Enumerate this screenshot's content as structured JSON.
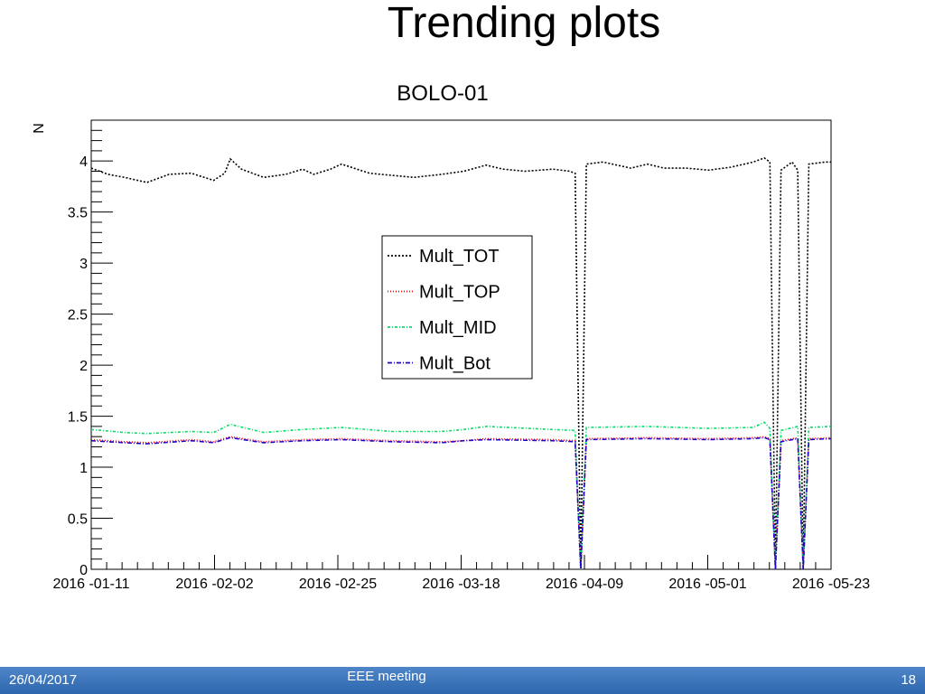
{
  "slide": {
    "title": "Trending plots"
  },
  "footer": {
    "date": "26/04/2017",
    "meeting": "EEE meeting",
    "page": "18"
  },
  "chart_data": {
    "type": "line",
    "title": "BOLO-01",
    "xlabel": "",
    "ylabel": "N",
    "x_axis": "date",
    "xlim": [
      "2016-01-11",
      "2016-05-23"
    ],
    "ylim": [
      0,
      4.4
    ],
    "xticks": [
      "2016 -01-11",
      "2016 -02-02",
      "2016 -02-25",
      "2016 -03-18",
      "2016 -04-09",
      "2016 -05-01",
      "2016 -05-23"
    ],
    "yticks": [
      "0",
      "0.5",
      "1",
      "1.5",
      "2",
      "2.5",
      "3",
      "3.5",
      "4"
    ],
    "grid": false,
    "legend_position": "center",
    "series": [
      {
        "name": "Mult_TOT",
        "color": "#000000",
        "dash": "2,2",
        "x": [
          "2016-01-11",
          "2016-01-14",
          "2016-01-17",
          "2016-01-21",
          "2016-01-25",
          "2016-01-29",
          "2016-02-02",
          "2016-02-04",
          "2016-02-05",
          "2016-02-07",
          "2016-02-11",
          "2016-02-15",
          "2016-02-18",
          "2016-02-20",
          "2016-02-23",
          "2016-02-25",
          "2016-03-01",
          "2016-03-05",
          "2016-03-09",
          "2016-03-14",
          "2016-03-18",
          "2016-03-22",
          "2016-03-25",
          "2016-03-29",
          "2016-04-03",
          "2016-04-06",
          "2016-04-07",
          "2016-04-08",
          "2016-04-09",
          "2016-04-12",
          "2016-04-17",
          "2016-04-20",
          "2016-04-23",
          "2016-04-27",
          "2016-05-01",
          "2016-05-05",
          "2016-05-09",
          "2016-05-11",
          "2016-05-12",
          "2016-05-13",
          "2016-05-14",
          "2016-05-16",
          "2016-05-17",
          "2016-05-18",
          "2016-05-19",
          "2016-05-22",
          "2016-05-23"
        ],
        "values": [
          3.93,
          3.87,
          3.84,
          3.79,
          3.87,
          3.88,
          3.81,
          3.88,
          4.02,
          3.92,
          3.84,
          3.87,
          3.92,
          3.87,
          3.92,
          3.97,
          3.88,
          3.86,
          3.84,
          3.87,
          3.9,
          3.96,
          3.92,
          3.9,
          3.92,
          3.9,
          3.88,
          0.0,
          3.97,
          3.99,
          3.93,
          3.97,
          3.93,
          3.93,
          3.91,
          3.94,
          3.99,
          4.03,
          3.99,
          0.0,
          3.91,
          3.99,
          3.91,
          0.0,
          3.97,
          3.99,
          3.99
        ]
      },
      {
        "name": "Mult_TOP",
        "color": "#ff0000",
        "dash": "1,2",
        "x": [
          "2016-01-11",
          "2016-01-17",
          "2016-01-21",
          "2016-01-29",
          "2016-02-02",
          "2016-02-05",
          "2016-02-11",
          "2016-02-18",
          "2016-02-25",
          "2016-03-05",
          "2016-03-14",
          "2016-03-18",
          "2016-03-22",
          "2016-04-03",
          "2016-04-07",
          "2016-04-08",
          "2016-04-09",
          "2016-04-20",
          "2016-05-01",
          "2016-05-09",
          "2016-05-11",
          "2016-05-12",
          "2016-05-13",
          "2016-05-14",
          "2016-05-17",
          "2016-05-18",
          "2016-05-19",
          "2016-05-23"
        ],
        "values": [
          1.27,
          1.25,
          1.24,
          1.27,
          1.25,
          1.3,
          1.25,
          1.27,
          1.28,
          1.26,
          1.25,
          1.26,
          1.28,
          1.27,
          1.26,
          0.0,
          1.28,
          1.29,
          1.28,
          1.29,
          1.3,
          1.28,
          0.0,
          1.26,
          1.29,
          0.0,
          1.28,
          1.29
        ]
      },
      {
        "name": "Mult_MID",
        "color": "#00dd66",
        "dash": "3,2,1,2",
        "x": [
          "2016-01-11",
          "2016-01-17",
          "2016-01-21",
          "2016-01-29",
          "2016-02-02",
          "2016-02-05",
          "2016-02-11",
          "2016-02-18",
          "2016-02-25",
          "2016-03-05",
          "2016-03-14",
          "2016-03-18",
          "2016-03-22",
          "2016-04-03",
          "2016-04-07",
          "2016-04-08",
          "2016-04-09",
          "2016-04-20",
          "2016-05-01",
          "2016-05-09",
          "2016-05-11",
          "2016-05-12",
          "2016-05-13",
          "2016-05-14",
          "2016-05-17",
          "2016-05-18",
          "2016-05-19",
          "2016-05-23"
        ],
        "values": [
          1.37,
          1.34,
          1.33,
          1.35,
          1.34,
          1.42,
          1.34,
          1.37,
          1.39,
          1.35,
          1.35,
          1.37,
          1.4,
          1.37,
          1.36,
          0.0,
          1.39,
          1.4,
          1.38,
          1.39,
          1.44,
          1.38,
          0.0,
          1.36,
          1.4,
          0.0,
          1.39,
          1.4
        ]
      },
      {
        "name": "Mult_Bot",
        "color": "#2200cc",
        "dash": "5,2,1,2",
        "x": [
          "2016-01-11",
          "2016-01-17",
          "2016-01-21",
          "2016-01-29",
          "2016-02-02",
          "2016-02-05",
          "2016-02-11",
          "2016-02-18",
          "2016-02-25",
          "2016-03-05",
          "2016-03-14",
          "2016-03-18",
          "2016-03-22",
          "2016-04-03",
          "2016-04-07",
          "2016-04-08",
          "2016-04-09",
          "2016-04-20",
          "2016-05-01",
          "2016-05-09",
          "2016-05-11",
          "2016-05-12",
          "2016-05-13",
          "2016-05-14",
          "2016-05-17",
          "2016-05-18",
          "2016-05-19",
          "2016-05-23"
        ],
        "values": [
          1.26,
          1.24,
          1.23,
          1.26,
          1.24,
          1.29,
          1.24,
          1.26,
          1.27,
          1.25,
          1.24,
          1.26,
          1.27,
          1.26,
          1.25,
          0.0,
          1.27,
          1.28,
          1.27,
          1.28,
          1.29,
          1.27,
          0.0,
          1.25,
          1.28,
          0.0,
          1.27,
          1.28
        ]
      }
    ]
  }
}
